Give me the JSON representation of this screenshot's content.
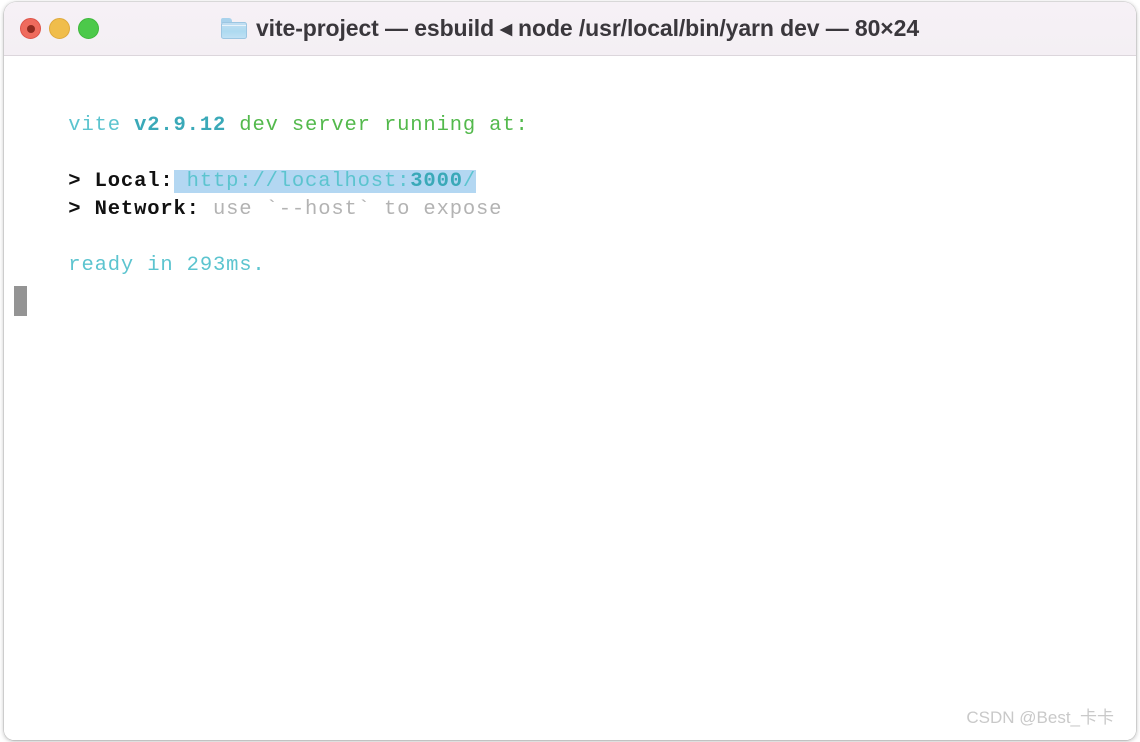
{
  "window": {
    "title": "vite-project — esbuild ◂ node /usr/local/bin/yarn dev — 80×24",
    "folder_icon": "folder-icon",
    "traffic_lights": [
      {
        "name": "close",
        "label": "Close",
        "color": "#ef6b5d"
      },
      {
        "name": "minimize",
        "label": "Minimize",
        "color": "#f0bd4b"
      },
      {
        "name": "zoom",
        "label": "Zoom",
        "color": "#4cc94a"
      }
    ],
    "titlebar_bg": "#f5f0f5",
    "terminal_bg": "#ffffff"
  },
  "terminal": {
    "clipped_top_line": "                     .",
    "lines": {
      "vite_label": "  vite",
      "vite_version": " v2.9.12",
      "vite_tagline": " dev server running at:",
      "local_prefix": "  > Local:",
      "local_url_head": " http://localhost:",
      "local_url_port": "3000",
      "local_url_tail": "/",
      "network_prefix": "  > Network:",
      "network_value": " use `--host` to expose",
      "ready_line": "  ready in 293ms."
    },
    "cursor": "block-cursor",
    "colors": {
      "cyan": "#5cc4cf",
      "cyan_bold": "#3aa9b8",
      "green": "#53b94c",
      "black": "#111111",
      "gray": "#b3b3b3",
      "selection": "#b3d7f2",
      "cursor": "#949494"
    }
  },
  "watermark": {
    "text": "CSDN @Best_卡卡"
  }
}
